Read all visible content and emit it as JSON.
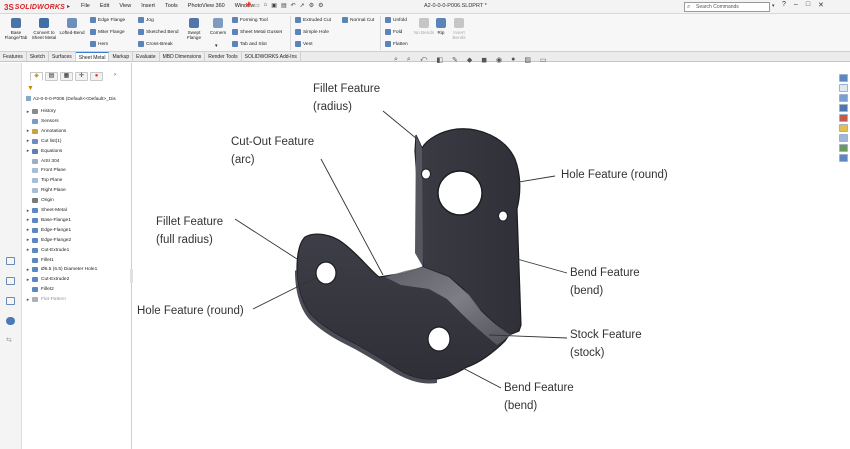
{
  "titlebar": {
    "logo_prefix": "3S",
    "logo_text": "SOLIDWORKS",
    "menu": [
      "File",
      "Edit",
      "View",
      "Insert",
      "Tools",
      "PhotoView 360",
      "Window"
    ],
    "doc_title": "A2-0-0-0-P006.SLDPRT *",
    "search_placeholder": "Search Commands"
  },
  "ribbon": {
    "big_buttons": [
      {
        "label": "Base Flange/Tab"
      },
      {
        "label": "Convert to Sheet Metal"
      },
      {
        "label": "Lofted-Bend"
      }
    ],
    "group1": [
      "Edge Flange",
      "Miter Flange",
      "Hem"
    ],
    "group2": [
      "Jog",
      "Sketched Bend",
      "Cross-Break"
    ],
    "swept_flange": "Swept Flange",
    "corners": "Corners",
    "group3": [
      "Forming Tool",
      "Sheet Metal Gusset",
      "Tab and Slot"
    ],
    "group4": [
      "Extruded Cut",
      "Simple Hole",
      "Vent"
    ],
    "normal_cut": "Normal Cut",
    "group5": [
      "Unfold",
      "Fold",
      "Flatten"
    ],
    "no_bends": "No Bends",
    "rip": "Rip",
    "insert_bends": "Insert Bends"
  },
  "tabs": [
    "Features",
    "Sketch",
    "Surfaces",
    "Sheet Metal",
    "Markup",
    "Evaluate",
    "MBD Dimensions",
    "Render Tools",
    "SOLIDWORKS Add-Ins"
  ],
  "active_tab": "Sheet Metal",
  "tree": {
    "root": "A2-0-0-0-P006  (Default<<Default>_Dis",
    "items": [
      {
        "label": "History",
        "expand": "▸",
        "color": "#8a8a8a"
      },
      {
        "label": "Sensors",
        "expand": "",
        "color": "#7a9cc4"
      },
      {
        "label": "Annotations",
        "expand": "▸",
        "color": "#c9a33c"
      },
      {
        "label": "Cut list(1)",
        "expand": "▸",
        "color": "#6a8fbf"
      },
      {
        "label": "Equations",
        "expand": "▸",
        "color": "#5a7fb0"
      },
      {
        "label": "AISI 304",
        "expand": "",
        "color": "#9ab0c8"
      },
      {
        "label": "Front Plane",
        "expand": "",
        "color": "#a9bcd6"
      },
      {
        "label": "Top Plane",
        "expand": "",
        "color": "#a9bcd6"
      },
      {
        "label": "Right Plane",
        "expand": "",
        "color": "#a9bcd6"
      },
      {
        "label": "Origin",
        "expand": "",
        "color": "#7a7a7a"
      },
      {
        "label": "Sheet-Metal",
        "expand": "▸",
        "color": "#5c87c0"
      },
      {
        "label": "Base-Flange1",
        "expand": "▸",
        "color": "#5c87c0"
      },
      {
        "label": "Edge-Flange1",
        "expand": "▸",
        "color": "#5c87c0"
      },
      {
        "label": "Edge-Flange2",
        "expand": "▸",
        "color": "#5c87c0"
      },
      {
        "label": "Cut-Extrude1",
        "expand": "▸",
        "color": "#5c87c0"
      },
      {
        "label": "Fillet1",
        "expand": "",
        "color": "#5c87c0"
      },
      {
        "label": "Ø6.5 (6.5) Diameter Hole1",
        "expand": "▸",
        "color": "#5c87c0"
      },
      {
        "label": "Cut-Extrude2",
        "expand": "▸",
        "color": "#5c87c0"
      },
      {
        "label": "Fillet2",
        "expand": "",
        "color": "#5c87c0"
      },
      {
        "label": "Flat-Pattern",
        "expand": "▸",
        "color": "#b0b0b0"
      }
    ]
  },
  "callouts": {
    "fillet_radius": [
      "Fillet Feature",
      "(radius)"
    ],
    "cutout_arc": [
      "Cut-Out Feature",
      "(arc)"
    ],
    "hole_round_top": [
      "Hole Feature (round)"
    ],
    "fillet_full": [
      "Fillet Feature",
      "(full radius)"
    ],
    "bend_right": [
      "Bend Feature",
      "(bend)"
    ],
    "hole_round_left": [
      "Hole Feature (round)"
    ],
    "stock": [
      "Stock Feature",
      "(stock)"
    ],
    "bend_bottom": [
      "Bend Feature",
      "(bend)"
    ]
  }
}
